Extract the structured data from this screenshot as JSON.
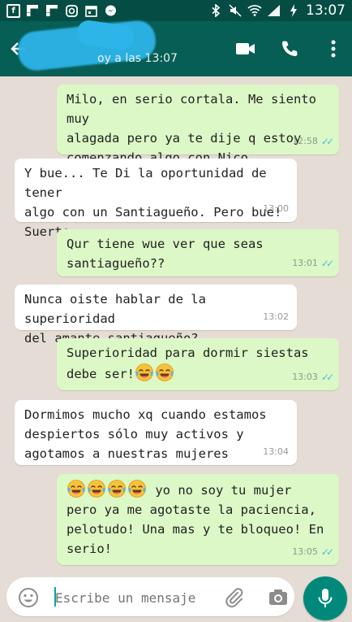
{
  "status_bar": {
    "time": "13:07",
    "left_icons": [
      "facebook-icon",
      "flipboard-icon",
      "flipboard-icon",
      "instagram-icon",
      "calendar-icon",
      "messenger-icon"
    ],
    "right_icons": [
      "bluetooth-icon",
      "mute-icon",
      "wifi-icon",
      "signal-icon",
      "charging-icon"
    ]
  },
  "header": {
    "last_seen": "oy a las 13:07",
    "actions": [
      "video-call-icon",
      "phone-icon",
      "more-icon"
    ]
  },
  "messages": [
    {
      "direction": "out",
      "text": "Milo, en serio cortala. Me siento muy\nalagada pero ya te dije q estoy\ncomenzando algo con Nico.",
      "time": "12:58",
      "read": true
    },
    {
      "direction": "in",
      "text": "Y bue... Te Di la oportunidad de tener\nalgo con un Santiagueño. Pero bue!\nSuerte",
      "time": "13:00"
    },
    {
      "direction": "out",
      "text": "Qur tiene wue ver que seas\nsantiagueño??",
      "time": "13:01",
      "read": true
    },
    {
      "direction": "in",
      "text": "Nunca oiste hablar de la superioridad\ndel amante santiagueño?",
      "time": "13:02"
    },
    {
      "direction": "out",
      "text": "Superioridad para dormir siestas\ndebe ser!",
      "emoji_count": 2,
      "time": "13:03",
      "read": true
    },
    {
      "direction": "in",
      "text": "Dormimos mucho xq cuando estamos\ndespiertos sólo muy activos y\nagotamos a nuestras mujeres",
      "time": "13:04"
    },
    {
      "direction": "out",
      "text": "yo no soy tu mujer\npero ya me agotaste la paciencia,\npelotudo! Una mas y te bloqueo! En\nserio!",
      "emoji_count": 4,
      "time": "13:05",
      "read": true
    }
  ],
  "input": {
    "placeholder": "Escribe un mensaje"
  },
  "colors": {
    "header": "#075e54",
    "status_bar": "#054d44",
    "outgoing_bubble": "#dcf8c6",
    "incoming_bubble": "#ffffff",
    "read_ticks": "#4fb8e8",
    "mic_button": "#00897b",
    "contact_scribble": "#2db4e8"
  }
}
